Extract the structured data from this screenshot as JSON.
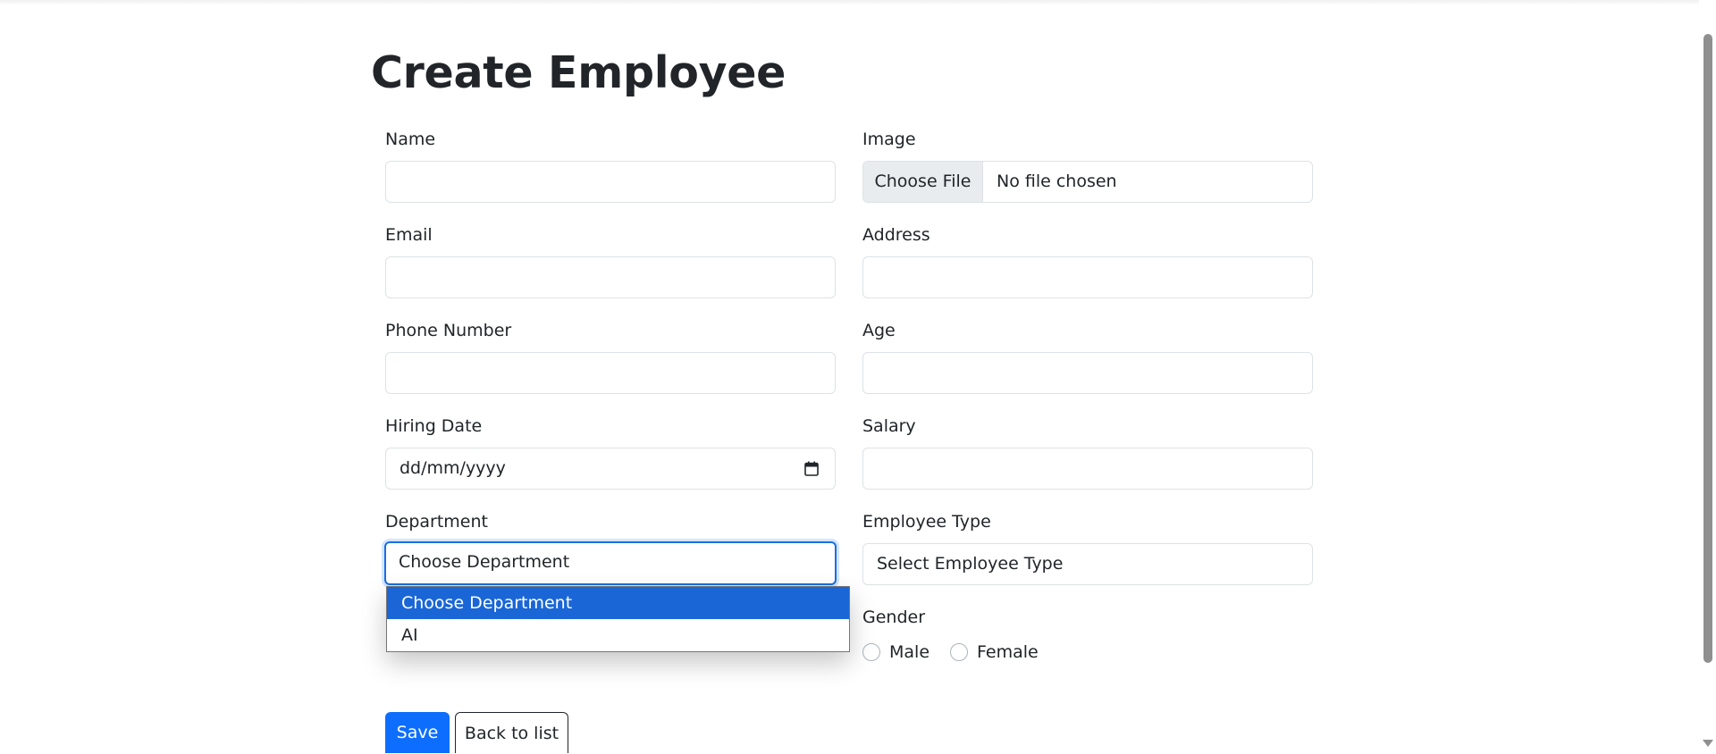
{
  "page": {
    "title": "Create Employee"
  },
  "form": {
    "name": {
      "label": "Name",
      "value": ""
    },
    "image": {
      "label": "Image",
      "button": "Choose File",
      "status": "No file chosen"
    },
    "email": {
      "label": "Email",
      "value": ""
    },
    "address": {
      "label": "Address",
      "value": ""
    },
    "phone": {
      "label": "Phone Number",
      "value": ""
    },
    "age": {
      "label": "Age",
      "value": ""
    },
    "hiring_date": {
      "label": "Hiring Date",
      "placeholder": "dd/mm/yyyy"
    },
    "salary": {
      "label": "Salary",
      "value": ""
    },
    "department": {
      "label": "Department",
      "selected": "Choose Department",
      "options": [
        "Choose Department",
        "AI"
      ]
    },
    "employee_type": {
      "label": "Employee Type",
      "selected": "Select Employee Type"
    },
    "gender": {
      "label": "Gender",
      "options": [
        "Male",
        "Female"
      ]
    }
  },
  "actions": {
    "save": "Save",
    "back": "Back to list"
  },
  "colors": {
    "primary": "#0d6efd",
    "dropdown_highlight": "#1a66d6",
    "text": "#212529",
    "border": "#dee2e6"
  }
}
